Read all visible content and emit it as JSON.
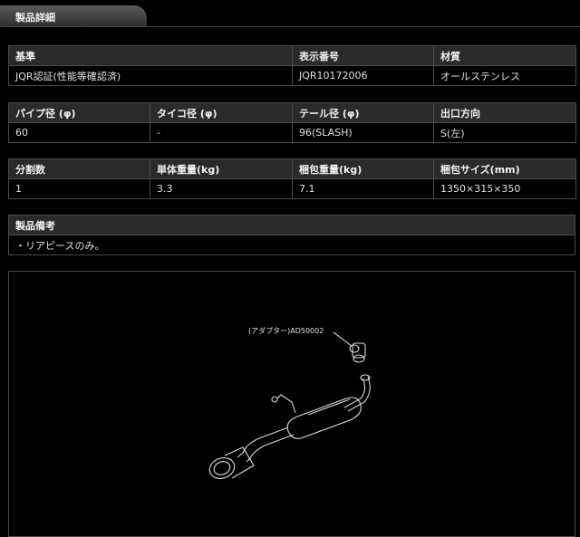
{
  "section": {
    "title": "製品詳細"
  },
  "table1": {
    "headers": [
      "基準",
      "表示番号",
      "材質"
    ],
    "values": [
      "JQR認証(性能等確認済)",
      "JQR10172006",
      "オールステンレス"
    ]
  },
  "table2": {
    "headers": [
      "パイプ径 (φ)",
      "タイコ径 (φ)",
      "テール径 (φ)",
      "出口方向"
    ],
    "values": [
      "60",
      "-",
      "96(SLASH)",
      "S(左)"
    ]
  },
  "table3": {
    "headers": [
      "分割数",
      "単体重量(kg)",
      "梱包重量(kg)",
      "梱包サイズ(mm)"
    ],
    "values": [
      "1",
      "3.3",
      "7.1",
      "1350×315×350"
    ]
  },
  "table4": {
    "header": "製品備考",
    "value": "・リアピースのみ。"
  },
  "diagram": {
    "adapter_label": "(アダプター)AD50002"
  }
}
